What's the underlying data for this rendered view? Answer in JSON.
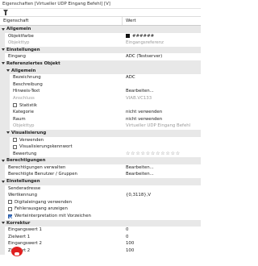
{
  "window": {
    "title": "Eigenschaften [Virtueller UDP Eingang Befehl] [V]"
  },
  "toolbar": {
    "filter_icon": "filter-icon"
  },
  "columns": {
    "name": "Eigenschaft",
    "value": "Wert"
  },
  "rows": [
    {
      "type": "cat",
      "level": 0,
      "label": "Allgemein"
    },
    {
      "type": "prop",
      "level": 0,
      "label": "Objektfarbe",
      "value": "######",
      "swatch": "#111111"
    },
    {
      "type": "prop",
      "level": 0,
      "label": "Objekttyp",
      "value": "Eingangsreferenz",
      "disabled": true
    },
    {
      "type": "cat",
      "level": 0,
      "label": "Einstellungen"
    },
    {
      "type": "prop",
      "level": 0,
      "label": "Eingang",
      "value": "ADC (Testserver)"
    },
    {
      "type": "cat",
      "level": 0,
      "label": "Referenziertes Objekt"
    },
    {
      "type": "cat",
      "level": 1,
      "label": "Allgemein"
    },
    {
      "type": "prop",
      "level": 1,
      "label": "Bezeichnung",
      "value": "ADC"
    },
    {
      "type": "prop",
      "level": 1,
      "label": "Beschreibung",
      "value": ""
    },
    {
      "type": "prop",
      "level": 1,
      "label": "Hinweis-Text",
      "value": "Bearbeiten..."
    },
    {
      "type": "prop",
      "level": 1,
      "label": "Anschluss",
      "value": "VIAB.VC133",
      "disabled": true
    },
    {
      "type": "check",
      "level": 1,
      "label": "Statistik",
      "checked": false
    },
    {
      "type": "prop",
      "level": 1,
      "label": "Kategorie",
      "value": "nicht verwenden"
    },
    {
      "type": "prop",
      "level": 1,
      "label": "Raum",
      "value": "nicht verwenden"
    },
    {
      "type": "prop",
      "level": 1,
      "label": "Objekttyp",
      "value": "Virtueller UDP Eingang Befehl",
      "disabled": true
    },
    {
      "type": "cat",
      "level": 1,
      "label": "Visualisierung"
    },
    {
      "type": "check",
      "level": 1,
      "label": "Verwenden",
      "checked": false
    },
    {
      "type": "check",
      "level": 1,
      "label": "Visualisierungskennwort",
      "checked": false
    },
    {
      "type": "prop",
      "level": 1,
      "label": "Bewertung",
      "value": "☆☆☆☆☆☆☆☆☆☆☆",
      "stars": true
    },
    {
      "type": "cat",
      "level": 0,
      "label": "Berechtigungen"
    },
    {
      "type": "prop",
      "level": 0,
      "label": "Berechtigungen verwalten",
      "value": "Bearbeiten..."
    },
    {
      "type": "prop",
      "level": 0,
      "label": "Berechtigte Benutzer / Gruppen",
      "value": "Bearbeiten..."
    },
    {
      "type": "cat",
      "level": 0,
      "label": "Einstellungen"
    },
    {
      "type": "prop",
      "level": 0,
      "label": "Senderadresse",
      "value": ""
    },
    {
      "type": "prop",
      "level": 0,
      "label": "Wertkennung",
      "value": "{0,3118},V"
    },
    {
      "type": "check",
      "level": 0,
      "label": "Digitaleingang verwenden",
      "checked": false
    },
    {
      "type": "check",
      "level": 0,
      "label": "Fehlerausgang anzeigen",
      "checked": false
    },
    {
      "type": "check",
      "level": 0,
      "label": "Werteinterpretation mit Vorzeichen",
      "checked": true
    },
    {
      "type": "cat",
      "level": 0,
      "label": "Korrektur"
    },
    {
      "type": "prop",
      "level": 0,
      "label": "Eingangswert 1",
      "value": "0"
    },
    {
      "type": "prop",
      "level": 0,
      "label": "Zielwert 1",
      "value": "0"
    },
    {
      "type": "prop",
      "level": 0,
      "label": "Eingangswert 2",
      "value": "100"
    },
    {
      "type": "prop",
      "level": 0,
      "label": "Zielwert 2",
      "value": "100"
    }
  ]
}
